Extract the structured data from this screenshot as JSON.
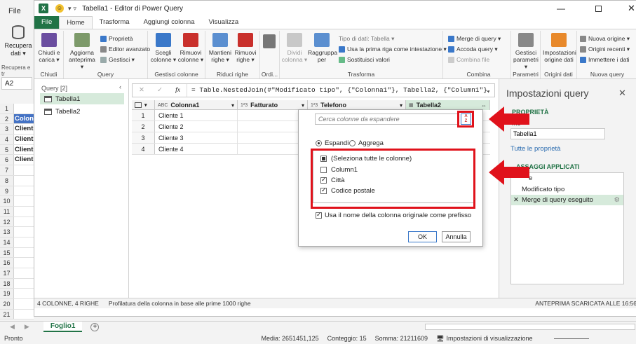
{
  "excel": {
    "file_tab": "File",
    "recupera_label": "Recupera dati ▾",
    "recupera_sub": "Recupera e tr",
    "name_box": "A2",
    "rows": [
      "1",
      "2",
      "3",
      "4",
      "5",
      "6",
      "7",
      "8",
      "9",
      "10",
      "11",
      "12",
      "13",
      "14",
      "15",
      "16",
      "17",
      "18",
      "19",
      "20",
      "21"
    ],
    "cells": [
      "",
      "Colon",
      "Client",
      "Client",
      "Client",
      "Client"
    ],
    "sheet_tab": "Foglio1",
    "status_left": "Pronto",
    "status_media": "Media: 2651451,125",
    "status_count": "Conteggio: 15",
    "status_sum": "Somma: 21211609",
    "status_view": "Impostazioni di visualizzazione"
  },
  "title": "Tabella1 - Editor di Power Query",
  "ribbon_tabs": [
    "File",
    "Home",
    "Trasforma",
    "Aggiungi colonna",
    "Visualizza"
  ],
  "ribbon": {
    "chiudi": "Chiudi e carica ▾",
    "chiudi_group": "Chiudi",
    "aggiorna": "Aggiorna anteprima ▾",
    "proprieta": "Proprietà",
    "editor": "Editor avanzato",
    "gestisci": "Gestisci ▾",
    "query_group": "Query",
    "scegli": "Scegli colonne ▾",
    "rimuovi_col": "Rimuovi colonne ▾",
    "col_group": "Gestisci colonne",
    "mantieni": "Mantieni righe ▾",
    "rimuovi_righe": "Rimuovi righe ▾",
    "righe_group": "Riduci righe",
    "ordina_group": "Ordi...",
    "dividi": "Dividi colonna ▾",
    "raggruppa": "Raggruppa per",
    "tipo_dati": "Tipo di dati: Tabella ▾",
    "prima_riga": "Usa la prima riga come intestazione ▾",
    "sostituisci": "Sostituisci valori",
    "trasforma_group": "Trasforma",
    "merge": "Merge di query ▾",
    "accoda": "Accoda query ▾",
    "combina_file": "Combina file",
    "combina_group": "Combina",
    "gestisci_param": "Gestisci parametri ▾",
    "parametri_group": "Parametri",
    "impostazioni_origine": "Impostazioni origine dati",
    "origini_group": "Origini dati",
    "nuova_origine": "Nuova origine ▾",
    "origini_recenti": "Origini recenti ▾",
    "immetti": "Immettere i dati",
    "nuova_query_group": "Nuova query"
  },
  "queries": {
    "header": "Query [2]",
    "items": [
      "Tabella1",
      "Tabella2"
    ]
  },
  "formula": "= Table.NestedJoin(#\"Modificato tipo\", {\"Colonna1\"}, Tabella2, {\"Column1\"},",
  "grid": {
    "columns": [
      {
        "type": "ABC",
        "name": "Colonna1"
      },
      {
        "type": "123",
        "name": "Fatturato"
      },
      {
        "type": "123",
        "name": "Telefono"
      },
      {
        "type": "tbl",
        "name": "Tabella2"
      }
    ],
    "rows": [
      {
        "n": "1",
        "c1": "Cliente 1"
      },
      {
        "n": "2",
        "c1": "Cliente 2"
      },
      {
        "n": "3",
        "c1": "Cliente 3"
      },
      {
        "n": "4",
        "c1": "Cliente 4"
      }
    ]
  },
  "popup": {
    "search_placeholder": "Cerca colonne da espandere",
    "espandi": "Espandi",
    "aggrega": "Aggrega",
    "select_all": "(Seleziona tutte le colonne)",
    "columns": [
      {
        "name": "Column1",
        "checked": false
      },
      {
        "name": "Città",
        "checked": true
      },
      {
        "name": "Codice postale",
        "checked": true
      }
    ],
    "prefix": "Usa il nome della colonna originale come prefisso",
    "ok": "OK",
    "cancel": "Annulla"
  },
  "settings": {
    "title": "Impostazioni query",
    "properties": "PROPRIETÀ",
    "name_label": "me",
    "name_value": "Tabella1",
    "all_props": "Tutte le proprietà",
    "steps_header": "ASSAGGI APPLICATI",
    "steps": [
      "e",
      "Modificato tipo",
      "Merge di query eseguito"
    ]
  },
  "pq_status_left": "4 COLONNE, 4 RIGHE",
  "pq_status_mid": "Profilatura della colonna in base alle prime 1000 righe",
  "pq_status_right": "ANTEPRIMA SCARICATA ALLE 16:56",
  "colors": {
    "excel_green": "#217346",
    "highlight_red": "#e0121b",
    "header_blue": "#4472c4"
  }
}
